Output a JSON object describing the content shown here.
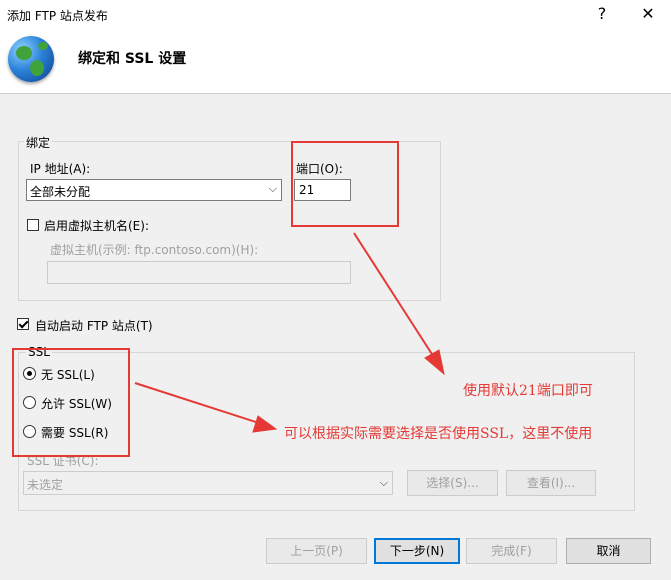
{
  "window": {
    "title": "添加 FTP 站点发布",
    "help_glyph": "?",
    "close_glyph": "✕"
  },
  "header": {
    "title": "绑定和 SSL 设置"
  },
  "binding": {
    "group_label": "绑定",
    "ip_label": "IP 地址(A):",
    "ip_value": "全部未分配",
    "port_label": "端口(O):",
    "port_value": "21",
    "virtual_host_checkbox_label": "启用虚拟主机名(E):",
    "virtual_host_checked": false,
    "virtual_host_label": "虚拟主机(示例: ftp.contoso.com)(H):",
    "virtual_host_value": ""
  },
  "autostart": {
    "label": "自动启动 FTP 站点(T)",
    "checked": true
  },
  "ssl": {
    "group_label": "SSL",
    "options": [
      {
        "label": "无 SSL(L)",
        "selected": true
      },
      {
        "label": "允许 SSL(W)",
        "selected": false
      },
      {
        "label": "需要 SSL(R)",
        "selected": false
      }
    ],
    "cert_label": "SSL 证书(C):",
    "cert_value": "未选定",
    "select_button": "选择(S)...",
    "view_button": "查看(I)..."
  },
  "annotations": {
    "port_note": "使用默认21端口即可",
    "ssl_note": "可以根据实际需要选择是否使用SSL，这里不使用",
    "color": "#e53935"
  },
  "footer": {
    "prev_button": "上一页(P)",
    "next_button": "下一步(N)",
    "finish_button": "完成(F)",
    "cancel_button": "取消"
  },
  "colors": {
    "accent": "#0078d7",
    "dialog_bg": "#f0f0f0"
  }
}
